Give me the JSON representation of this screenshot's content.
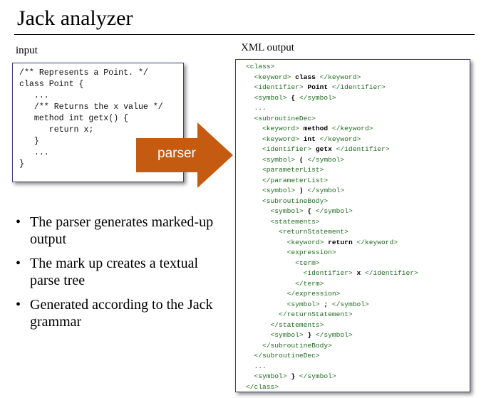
{
  "title": "Jack analyzer",
  "input_label": "input",
  "output_label": "XML output",
  "arrow_label": "parser",
  "colors": {
    "arrow": "#c55a11",
    "box_border": "#3a3f73",
    "code_comment": "#0a4a0a",
    "xml_tag": "#1f6b1f"
  },
  "input_code": [
    "/** Represents a Point. */",
    "class Point {",
    "   ...",
    "   /** Returns the x value */",
    "   method int getx() {",
    "      return x;",
    "   }",
    "   ...",
    "}"
  ],
  "xml_lines": [
    {
      "open": "<class>",
      "text": "",
      "close": ""
    },
    {
      "open": "  <keyword> ",
      "text": "class",
      "close": " </keyword>"
    },
    {
      "open": "  <identifier> ",
      "text": "Point",
      "close": " </identifier>"
    },
    {
      "open": "  <symbol> ",
      "text": "{",
      "close": " </symbol>"
    },
    {
      "open": "  ...",
      "text": "",
      "close": ""
    },
    {
      "open": "  <subroutineDec>",
      "text": "",
      "close": ""
    },
    {
      "open": "    <keyword> ",
      "text": "method",
      "close": " </keyword>"
    },
    {
      "open": "    <keyword> ",
      "text": "int",
      "close": " </keyword>"
    },
    {
      "open": "    <identifier> ",
      "text": "getx",
      "close": " </identifier>"
    },
    {
      "open": "    <symbol> ",
      "text": "(",
      "close": " </symbol>"
    },
    {
      "open": "    <parameterList>",
      "text": "",
      "close": ""
    },
    {
      "open": "    </parameterList>",
      "text": "",
      "close": ""
    },
    {
      "open": "    <symbol> ",
      "text": ")",
      "close": " </symbol>"
    },
    {
      "open": "    <subroutineBody>",
      "text": "",
      "close": ""
    },
    {
      "open": "      <symbol> ",
      "text": "{",
      "close": " </symbol>"
    },
    {
      "open": "      <statements>",
      "text": "",
      "close": ""
    },
    {
      "open": "        <returnStatement>",
      "text": "",
      "close": ""
    },
    {
      "open": "          <keyword> ",
      "text": "return",
      "close": " </keyword>"
    },
    {
      "open": "          <expression>",
      "text": "",
      "close": ""
    },
    {
      "open": "            <term>",
      "text": "",
      "close": ""
    },
    {
      "open": "              <identifier> ",
      "text": "x",
      "close": " </identifier>"
    },
    {
      "open": "            </term>",
      "text": "",
      "close": ""
    },
    {
      "open": "          </expression>",
      "text": "",
      "close": ""
    },
    {
      "open": "          <symbol> ",
      "text": ";",
      "close": " </symbol>"
    },
    {
      "open": "        </returnStatement>",
      "text": "",
      "close": ""
    },
    {
      "open": "      </statements>",
      "text": "",
      "close": ""
    },
    {
      "open": "      <symbol> ",
      "text": "}",
      "close": " </symbol>"
    },
    {
      "open": "    </subroutineBody>",
      "text": "",
      "close": ""
    },
    {
      "open": "  </subroutineDec>",
      "text": "",
      "close": ""
    },
    {
      "open": "  ...",
      "text": "",
      "close": ""
    },
    {
      "open": "  <symbol> ",
      "text": "}",
      "close": " </symbol>"
    },
    {
      "open": "</class>",
      "text": "",
      "close": ""
    }
  ],
  "bullets": [
    "The parser generates marked-up output",
    "The mark up creates a textual parse tree",
    "Generated according to the Jack grammar"
  ]
}
